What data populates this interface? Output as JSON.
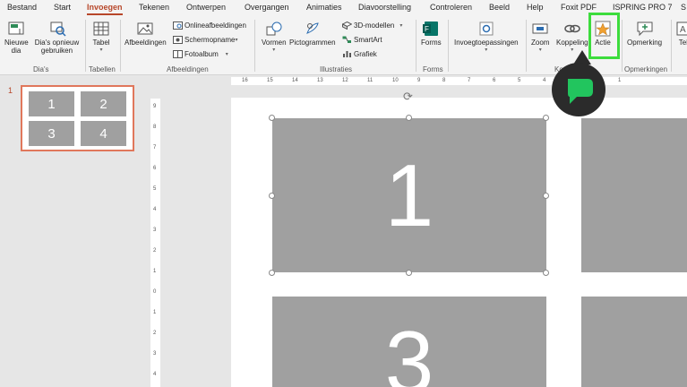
{
  "tabs": [
    "Bestand",
    "Start",
    "Invoegen",
    "Tekenen",
    "Ontwerpen",
    "Overgangen",
    "Animaties",
    "Diavoorstelling",
    "Controleren",
    "Beeld",
    "Help",
    "Foxit PDF",
    "ISPRING PRO 7",
    "S"
  ],
  "ribbon": {
    "new_slide": "Nieuwe dia",
    "reuse": "Dia's opnieuw gebruiken",
    "group_slides": "Dia's",
    "table": "Tabel",
    "group_tables": "Tabellen",
    "images": "Afbeeldingen",
    "online_images": "Onlineafbeeldingen",
    "screenshot": "Schermopname",
    "photo_album": "Fotoalbum",
    "group_images": "Afbeeldingen",
    "shapes": "Vormen",
    "icons": "Pictogrammen",
    "models_3d": "3D-modellen",
    "smartart": "SmartArt",
    "chart": "Grafiek",
    "group_illustrations": "Illustraties",
    "forms": "Forms",
    "group_forms": "Forms",
    "addins": "Invoegtoepassingen",
    "zoom": "Zoom",
    "link": "Koppeling",
    "action": "Actie",
    "group_links": "Ko",
    "comment": "Opmerking",
    "group_comments": "Opmerkingen",
    "text_cut": "Tek"
  },
  "slide_number": "1",
  "thumb_cells": [
    "1",
    "2",
    "3",
    "4"
  ],
  "slide_cells": [
    "1",
    "3"
  ],
  "hruler_labels": [
    "16",
    "15",
    "14",
    "13",
    "12",
    "11",
    "10",
    "9",
    "8",
    "7",
    "6",
    "5",
    "4",
    "3",
    "2",
    "1"
  ],
  "vruler_labels": [
    "9",
    "8",
    "7",
    "6",
    "5",
    "4",
    "3",
    "2",
    "1",
    "0",
    "1",
    "2",
    "3",
    "4"
  ],
  "colors": {
    "accent": "#b7472a",
    "highlight": "#3ddc3d",
    "cell": "#a0a0a0",
    "bubble": "#2b2b2b",
    "bubble_icon": "#22c55e"
  }
}
